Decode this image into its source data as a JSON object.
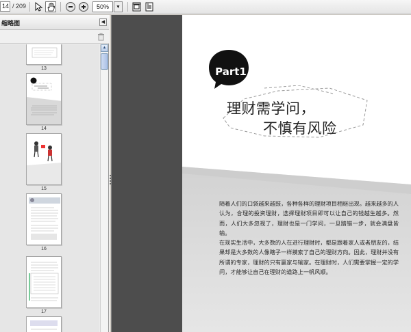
{
  "toolbar": {
    "current_page": "14",
    "total_pages": "/ 209",
    "zoom": "50%",
    "icons": [
      "select-arrow-icon",
      "hand-tool-icon",
      "zoom-out-icon",
      "zoom-in-icon",
      "fit-page-icon",
      "fit-width-icon"
    ]
  },
  "sidebar": {
    "title": "缩略图",
    "thumbnails": [
      {
        "label": "13"
      },
      {
        "label": "14"
      },
      {
        "label": "15"
      },
      {
        "label": "16"
      },
      {
        "label": "17"
      }
    ]
  },
  "document": {
    "part_label": "Part1",
    "title_line1": "理财需学问，",
    "title_line2": "不慎有风险",
    "paragraph1": "随着人们的口袋越来越鼓，各种各样的理财项目相继出现。越来越多的人认为，合理的投资理财，选择理财项目即可以让自己的钱越生越多。然而，人们大多忽视了，理财也是一门学问，一旦踏错一步，就会满盘皆输。",
    "paragraph2": "在现实生活中，大多数的人在进行理财时，都是跟着家人或者朋友的，结果却是大多数的人像瞎子一样摸索了自己的理财方向。因此，理财并没有所谓的专家，理财的只有赢家与输家。在理财时，人们需要掌握一定的学问，才能够让自己在理财的道路上一帆风顺。"
  }
}
